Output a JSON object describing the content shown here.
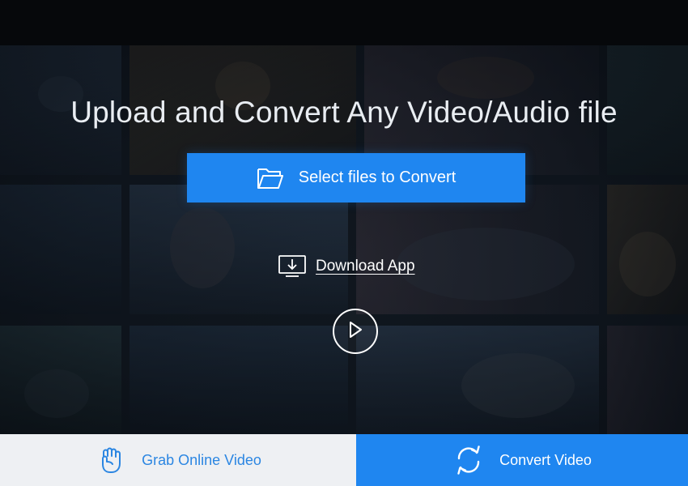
{
  "hero": {
    "title": "Upload and Convert Any Video/Audio file",
    "select_button_label": "Select files to Convert",
    "download_label": "Download App"
  },
  "tabs": [
    {
      "label": "Grab Online Video",
      "icon": "hand-fist-icon",
      "active": false
    },
    {
      "label": "Convert Video",
      "icon": "refresh-cycle-icon",
      "active": true
    }
  ],
  "icons": {
    "select_button": "folder-open-icon",
    "download": "download-monitor-icon",
    "play": "play-circle-icon"
  },
  "colors": {
    "accent": "#1f86f0",
    "tab_inactive_bg": "#eef0f3",
    "tab_inactive_text": "#2b86e2",
    "background": "#0b0f14"
  }
}
